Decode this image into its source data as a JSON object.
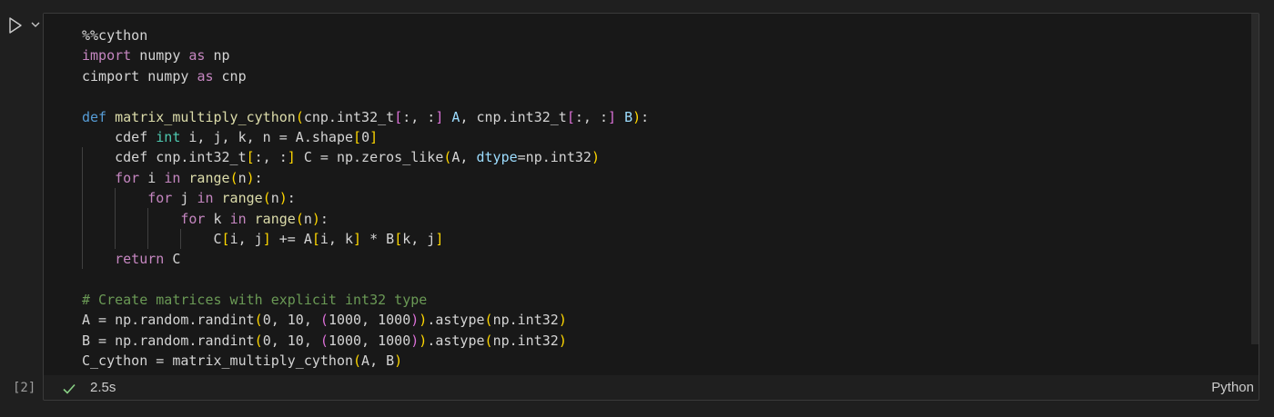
{
  "cell": {
    "execution_count": "[2]",
    "duration": "2.5s",
    "language": "Python",
    "icons": {
      "run": "play-icon",
      "expand": "chevron-down-icon",
      "status": "check-icon"
    },
    "colors": {
      "keyword": "#c586c0",
      "definition": "#569cd6",
      "function": "#dcdcaa",
      "type": "#4ec9b0",
      "parameter": "#9cdcfe",
      "bracket_1": "#ffd700",
      "bracket_2": "#da70d6",
      "bracket_3": "#179fff",
      "comment": "#6a9955",
      "success": "#89d185"
    }
  },
  "code": [
    [
      {
        "t": "%%cython"
      }
    ],
    [
      {
        "t": "import",
        "c": "kw"
      },
      {
        "t": " numpy "
      },
      {
        "t": "as",
        "c": "kw"
      },
      {
        "t": " np"
      }
    ],
    [
      {
        "t": "cimport numpy "
      },
      {
        "t": "as",
        "c": "kw"
      },
      {
        "t": " cnp"
      }
    ],
    [],
    [
      {
        "t": "def",
        "c": "def"
      },
      {
        "t": " "
      },
      {
        "t": "matrix_multiply_cython",
        "c": "fn"
      },
      {
        "t": "(",
        "c": "br1"
      },
      {
        "t": "cnp.int32_t"
      },
      {
        "t": "[",
        "c": "br2"
      },
      {
        "t": ":, :"
      },
      {
        "t": "]",
        "c": "br2"
      },
      {
        "t": " "
      },
      {
        "t": "A",
        "c": "param"
      },
      {
        "t": ", cnp.int32_t"
      },
      {
        "t": "[",
        "c": "br2"
      },
      {
        "t": ":, :"
      },
      {
        "t": "]",
        "c": "br2"
      },
      {
        "t": " "
      },
      {
        "t": "B",
        "c": "param"
      },
      {
        "t": ")",
        "c": "br1"
      },
      {
        "t": ":"
      }
    ],
    [
      {
        "t": "    cdef "
      },
      {
        "t": "int",
        "c": "ty"
      },
      {
        "t": " i, j, k, n = A.shape"
      },
      {
        "t": "[",
        "c": "br1"
      },
      {
        "t": "0"
      },
      {
        "t": "]",
        "c": "br1"
      }
    ],
    [
      {
        "t": "    cdef cnp.int32_t"
      },
      {
        "t": "[",
        "c": "br1"
      },
      {
        "t": ":, :"
      },
      {
        "t": "]",
        "c": "br1"
      },
      {
        "t": " C = np.zeros_like"
      },
      {
        "t": "(",
        "c": "br1"
      },
      {
        "t": "A, "
      },
      {
        "t": "dtype",
        "c": "param"
      },
      {
        "t": "=np.int32"
      },
      {
        "t": ")",
        "c": "br1"
      }
    ],
    [
      {
        "t": "    "
      },
      {
        "t": "for",
        "c": "kw"
      },
      {
        "t": " i "
      },
      {
        "t": "in",
        "c": "kw"
      },
      {
        "t": " "
      },
      {
        "t": "range",
        "c": "fn"
      },
      {
        "t": "(",
        "c": "br1"
      },
      {
        "t": "n"
      },
      {
        "t": ")",
        "c": "br1"
      },
      {
        "t": ":"
      }
    ],
    [
      {
        "t": "        "
      },
      {
        "t": "for",
        "c": "kw"
      },
      {
        "t": " j "
      },
      {
        "t": "in",
        "c": "kw"
      },
      {
        "t": " "
      },
      {
        "t": "range",
        "c": "fn"
      },
      {
        "t": "(",
        "c": "br1"
      },
      {
        "t": "n"
      },
      {
        "t": ")",
        "c": "br1"
      },
      {
        "t": ":"
      }
    ],
    [
      {
        "t": "            "
      },
      {
        "t": "for",
        "c": "kw"
      },
      {
        "t": " k "
      },
      {
        "t": "in",
        "c": "kw"
      },
      {
        "t": " "
      },
      {
        "t": "range",
        "c": "fn"
      },
      {
        "t": "(",
        "c": "br1"
      },
      {
        "t": "n"
      },
      {
        "t": ")",
        "c": "br1"
      },
      {
        "t": ":"
      }
    ],
    [
      {
        "t": "                C"
      },
      {
        "t": "[",
        "c": "br1"
      },
      {
        "t": "i, j"
      },
      {
        "t": "]",
        "c": "br1"
      },
      {
        "t": " += A"
      },
      {
        "t": "[",
        "c": "br1"
      },
      {
        "t": "i, k"
      },
      {
        "t": "]",
        "c": "br1"
      },
      {
        "t": " * B"
      },
      {
        "t": "[",
        "c": "br1"
      },
      {
        "t": "k, j"
      },
      {
        "t": "]",
        "c": "br1"
      }
    ],
    [
      {
        "t": "    "
      },
      {
        "t": "return",
        "c": "kw"
      },
      {
        "t": " C"
      }
    ],
    [],
    [
      {
        "t": "# Create matrices with explicit int32 type",
        "c": "cm"
      }
    ],
    [
      {
        "t": "A = np.random.randint"
      },
      {
        "t": "(",
        "c": "br1"
      },
      {
        "t": "0, 10, "
      },
      {
        "t": "(",
        "c": "br2"
      },
      {
        "t": "1000, 1000"
      },
      {
        "t": ")",
        "c": "br2"
      },
      {
        "t": ")",
        "c": "br1"
      },
      {
        "t": ".astype"
      },
      {
        "t": "(",
        "c": "br1"
      },
      {
        "t": "np.int32"
      },
      {
        "t": ")",
        "c": "br1"
      }
    ],
    [
      {
        "t": "B = np.random.randint"
      },
      {
        "t": "(",
        "c": "br1"
      },
      {
        "t": "0, 10, "
      },
      {
        "t": "(",
        "c": "br2"
      },
      {
        "t": "1000, 1000"
      },
      {
        "t": ")",
        "c": "br2"
      },
      {
        "t": ")",
        "c": "br1"
      },
      {
        "t": ".astype"
      },
      {
        "t": "(",
        "c": "br1"
      },
      {
        "t": "np.int32"
      },
      {
        "t": ")",
        "c": "br1"
      }
    ],
    [
      {
        "t": "C_cython = matrix_multiply_cython"
      },
      {
        "t": "(",
        "c": "br1"
      },
      {
        "t": "A, B"
      },
      {
        "t": ")",
        "c": "br1"
      }
    ]
  ]
}
